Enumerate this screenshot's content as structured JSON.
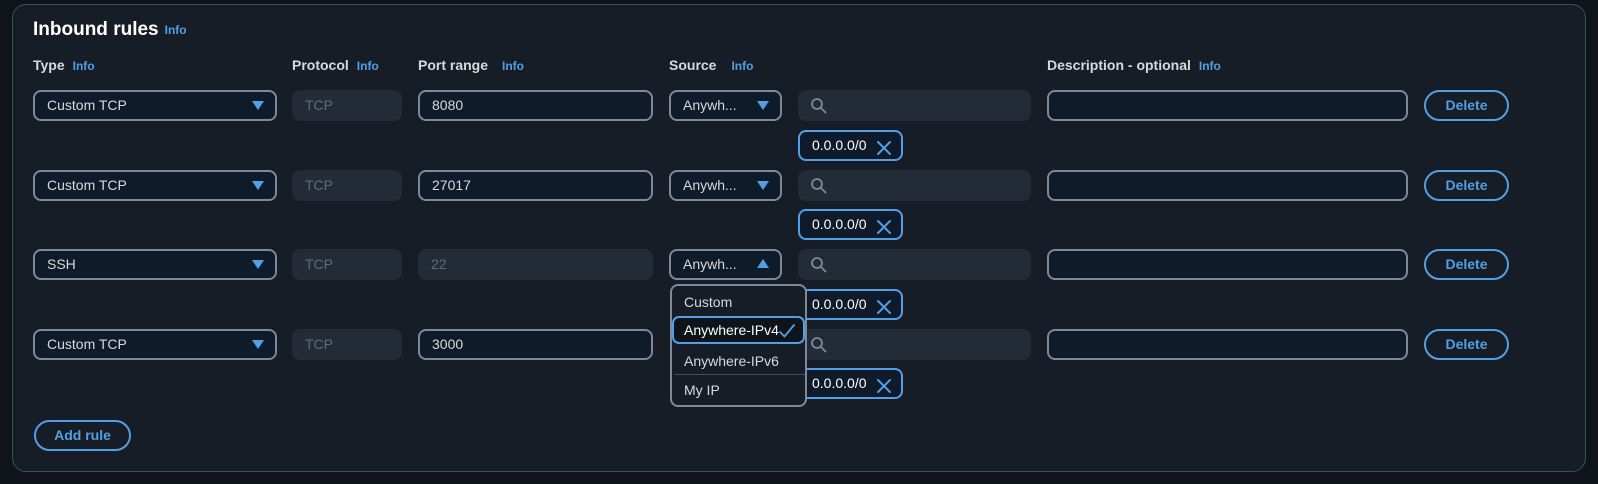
{
  "section": {
    "title": "Inbound rules",
    "info": "Info"
  },
  "headers": {
    "type": "Type",
    "protocol": "Protocol",
    "port_range": "Port range",
    "source": "Source",
    "description": "Description - optional",
    "info": "Info"
  },
  "rules": [
    {
      "type": "Custom TCP",
      "protocol": "TCP",
      "port": "8080",
      "source": "Anywh...",
      "cidr": "0.0.0.0/0",
      "description": "",
      "delete": "Delete"
    },
    {
      "type": "Custom TCP",
      "protocol": "TCP",
      "port": "27017",
      "source": "Anywh...",
      "cidr": "0.0.0.0/0",
      "description": "",
      "delete": "Delete"
    },
    {
      "type": "SSH",
      "protocol": "TCP",
      "port": "22",
      "source": "Anywh...",
      "cidr": "0.0.0.0/0",
      "description": "",
      "delete": "Delete"
    },
    {
      "type": "Custom TCP",
      "protocol": "TCP",
      "port": "3000",
      "source": "",
      "cidr": "0.0.0.0/0",
      "description": "",
      "delete": "Delete"
    }
  ],
  "source_dropdown": {
    "options": [
      "Custom",
      "Anywhere-IPv4",
      "Anywhere-IPv6",
      "My IP"
    ],
    "selected": "Anywhere-IPv4"
  },
  "add_rule": "Add rule",
  "colors": {
    "accent": "#539fe5",
    "background": "#161d26",
    "border": "#7d8998"
  }
}
